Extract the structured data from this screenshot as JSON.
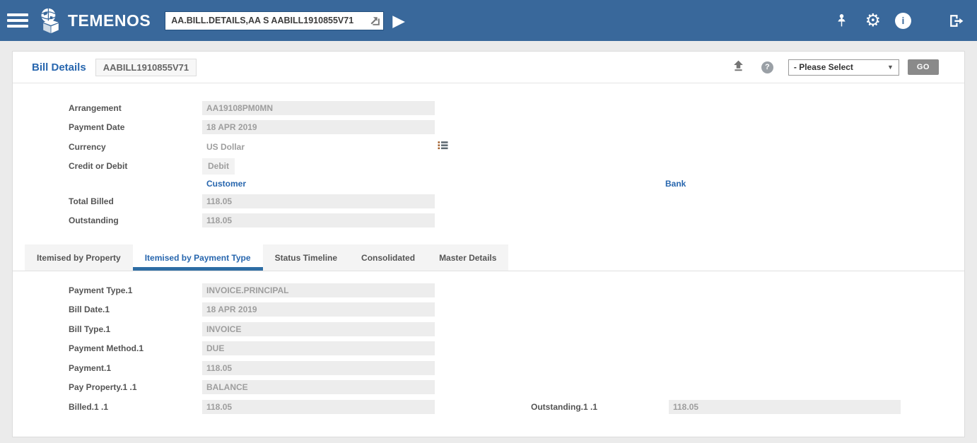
{
  "header": {
    "brand": "TEMENOS",
    "command": "AA.BILL.DETAILS,AA S AABILL1910855V71"
  },
  "icons": {
    "play": "▶",
    "gear": "⚙",
    "info": "i",
    "help": "?",
    "select_caret": "▼"
  },
  "page": {
    "title": "Bill Details",
    "bill_id": "AABILL1910855V71",
    "tool_select_value": "- Please Select",
    "go_label": "GO"
  },
  "details": {
    "arrangement": {
      "label": "Arrangement",
      "value": "AA19108PM0MN"
    },
    "payment_date": {
      "label": "Payment Date",
      "value": "18 APR 2019"
    },
    "currency": {
      "label": "Currency",
      "value": "US Dollar"
    },
    "credit_or_debit": {
      "label": "Credit or Debit",
      "value": "Debit"
    },
    "customer_link": "Customer",
    "bank_link": "Bank",
    "total_billed": {
      "label": "Total Billed",
      "value": "118.05"
    },
    "outstanding": {
      "label": "Outstanding",
      "value": "118.05"
    }
  },
  "tabs": {
    "items": [
      {
        "label": "Itemised by Property",
        "active": false
      },
      {
        "label": "Itemised by Payment Type",
        "active": true
      },
      {
        "label": "Status Timeline",
        "active": false
      },
      {
        "label": "Consolidated",
        "active": false
      },
      {
        "label": "Master Details",
        "active": false
      }
    ]
  },
  "payment_tab": {
    "payment_type": {
      "label": "Payment Type.1",
      "value": "INVOICE.PRINCIPAL"
    },
    "bill_date": {
      "label": "Bill Date.1",
      "value": "18 APR 2019"
    },
    "bill_type": {
      "label": "Bill Type.1",
      "value": "INVOICE"
    },
    "payment_method": {
      "label": "Payment Method.1",
      "value": "DUE"
    },
    "payment": {
      "label": "Payment.1",
      "value": "118.05"
    },
    "pay_property": {
      "label": "Pay Property.1 .1",
      "value": "BALANCE"
    },
    "billed": {
      "label": "Billed.1 .1",
      "value": "118.05"
    },
    "outstanding": {
      "label": "Outstanding.1 .1",
      "value": "118.05"
    }
  }
}
